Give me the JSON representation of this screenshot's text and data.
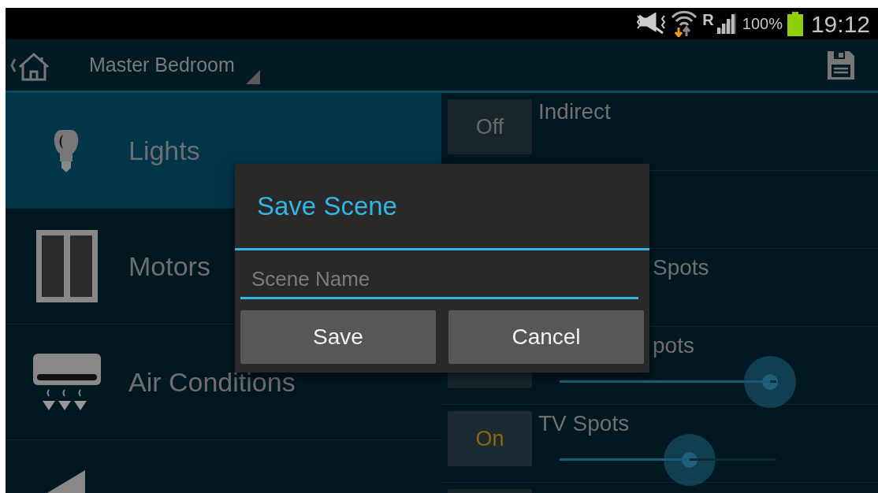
{
  "status_bar": {
    "network_type": "R",
    "battery": "100%",
    "time": "19:12"
  },
  "action_bar": {
    "title": "Master Bedroom"
  },
  "categories": [
    {
      "label": "Lights",
      "kind": "bulb",
      "selected": true
    },
    {
      "label": "Motors",
      "kind": "window",
      "selected": false
    },
    {
      "label": "Air Conditions",
      "kind": "ac",
      "selected": false
    },
    {
      "kind": "speaker",
      "selected": false
    }
  ],
  "controls": [
    {
      "toggle": {
        "label": "Off",
        "on": false
      },
      "label": "Indirect"
    },
    {
      "covered": true
    },
    {
      "label": "Spots",
      "covered": true
    },
    {
      "kind": "switch",
      "label": "pots",
      "covered": true,
      "level": 0.97
    },
    {
      "toggle": {
        "label": "On",
        "on": true
      },
      "label": "TV Spots",
      "level": 0.6
    },
    {
      "kind": "switch"
    }
  ],
  "dialog": {
    "title": "Save Scene",
    "field": {
      "placeholder": "Scene Name"
    },
    "buttons": [
      "Save",
      "Cancel"
    ]
  }
}
